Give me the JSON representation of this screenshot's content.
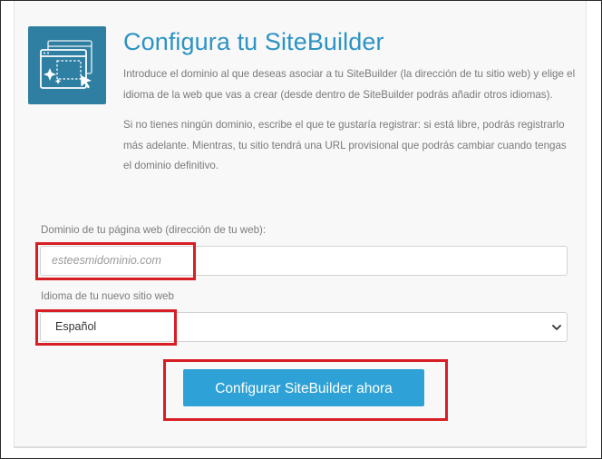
{
  "header": {
    "title": "Configura tu SiteBuilder",
    "paragraph1": "Introduce el dominio al que deseas asociar a tu SiteBuilder (la dirección de tu sitio web) y elige el idioma de la web que vas a crear (desde dentro de SiteBuilder podrás añadir otros idiomas).",
    "paragraph2": "Si no tienes ningún dominio, escribe el que te gustaría registrar: si está libre, podrás registrarlo más adelante. Mientras, tu sitio tendrá una URL provisional que podrás cambiar cuando tengas el dominio definitivo."
  },
  "logo": {
    "icon": "website-builder-sparkle-icon",
    "color": "#2f7fa2"
  },
  "form": {
    "domain_label": "Dominio de tu página web (dirección de tu web):",
    "domain_placeholder": "esteesmidominio.com",
    "domain_value": "",
    "language_label": "Idioma de tu nuevo sitio web",
    "language_selected": "Español",
    "submit_label": "Configurar SiteBuilder ahora"
  },
  "colors": {
    "accent": "#2ea2d6",
    "title": "#2d93c3",
    "highlight": "#d81e25"
  }
}
